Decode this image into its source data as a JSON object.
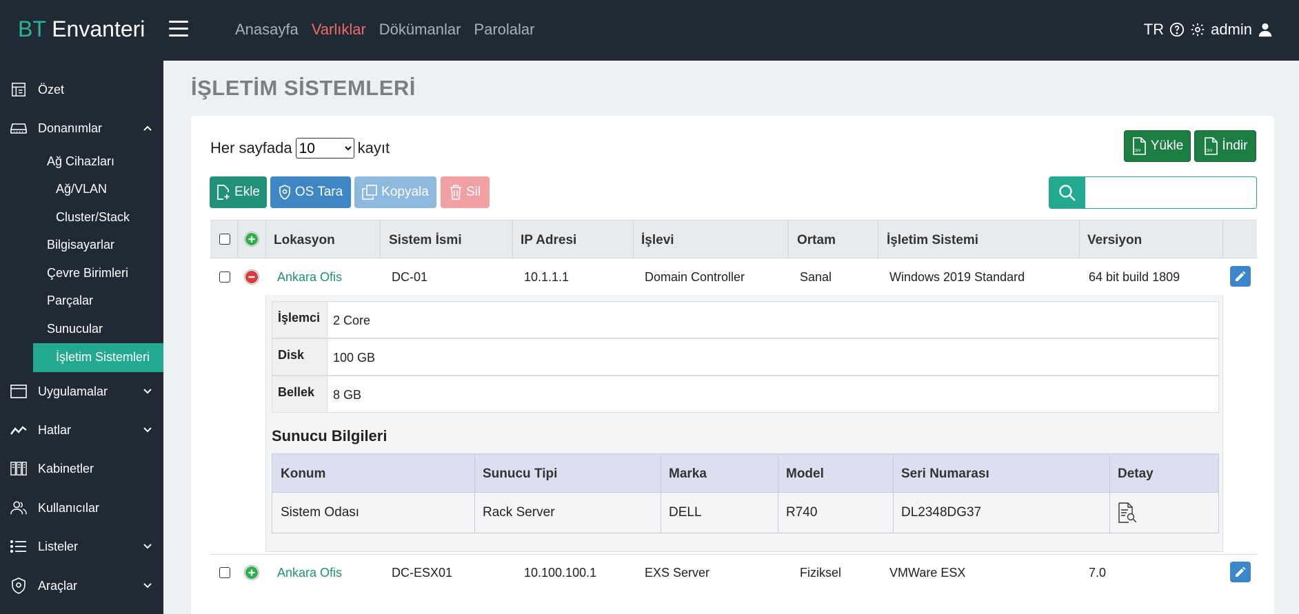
{
  "brand": {
    "prefix": "BT",
    "name": " Envanteri"
  },
  "topnav": [
    {
      "label": "Anasayfa",
      "active": false
    },
    {
      "label": "Varlıklar",
      "active": true
    },
    {
      "label": "Dökümanlar",
      "active": false
    },
    {
      "label": "Parolalar",
      "active": false
    }
  ],
  "topright": {
    "lang": "TR",
    "user": "admin"
  },
  "sidebar": {
    "items": [
      {
        "label": "Özet",
        "icon": "dashboard-icon"
      },
      {
        "label": "Donanımlar",
        "icon": "hardware-icon"
      },
      {
        "label": "Uygulamalar",
        "icon": "window-icon"
      },
      {
        "label": "Hatlar",
        "icon": "line-chart-icon"
      },
      {
        "label": "Kabinetler",
        "icon": "cabinet-icon"
      },
      {
        "label": "Kullanıcılar",
        "icon": "users-icon"
      },
      {
        "label": "Listeler",
        "icon": "list-icon"
      },
      {
        "label": "Araçlar",
        "icon": "shield-gear-icon"
      }
    ],
    "subitems": [
      "Ağ Cihazları",
      "Ağ/VLAN",
      "Cluster/Stack",
      "Bilgisayarlar",
      "Çevre Birimleri",
      "Parçalar",
      "Sunucular",
      "İşletim Sistemleri"
    ]
  },
  "page": {
    "title": "İŞLETİM SİSTEMLERİ"
  },
  "perpage": {
    "prefix": "Her sayfada",
    "value": "10",
    "suffix": "kayıt"
  },
  "buttons": {
    "upload": "Yükle",
    "download": "İndir",
    "add": "Ekle",
    "scan": "OS Tara",
    "copy": "Kopyala",
    "delete": "Sil",
    "csv": "csv"
  },
  "search": {
    "placeholder": ""
  },
  "table": {
    "headers": [
      "Lokasyon",
      "Sistem İsmi",
      "IP Adresi",
      "İşlevi",
      "Ortam",
      "İşletim Sistemi",
      "Versiyon"
    ],
    "rows": [
      {
        "location": "Ankara Ofis",
        "name": "DC-01",
        "ip": "10.1.1.1",
        "role": "Domain Controller",
        "env": "Sanal",
        "os": "Windows 2019 Standard",
        "version": "64 bit build 1809"
      },
      {
        "location": "Ankara Ofis",
        "name": "DC-ESX01",
        "ip": "10.100.100.1",
        "role": "EXS Server",
        "env": "Fiziksel",
        "os": "VMWare ESX",
        "version": "7.0"
      }
    ]
  },
  "detail": {
    "specs": [
      {
        "key": "İşlemci",
        "value": "2 Core"
      },
      {
        "key": "Disk",
        "value": "100 GB"
      },
      {
        "key": "Bellek",
        "value": "8 GB"
      }
    ],
    "server_title": "Sunucu Bilgileri",
    "server_headers": [
      "Konum",
      "Sunucu Tipi",
      "Marka",
      "Model",
      "Seri Numarası",
      "Detay"
    ],
    "server_row": {
      "location": "Sistem Odası",
      "type": "Rack Server",
      "brand": "DELL",
      "model": "R740",
      "serial": "DL2348DG37"
    }
  },
  "colors": {
    "accent": "#22a98f",
    "topbar": "#1f2a34",
    "active_nav": "#f06a6a"
  }
}
